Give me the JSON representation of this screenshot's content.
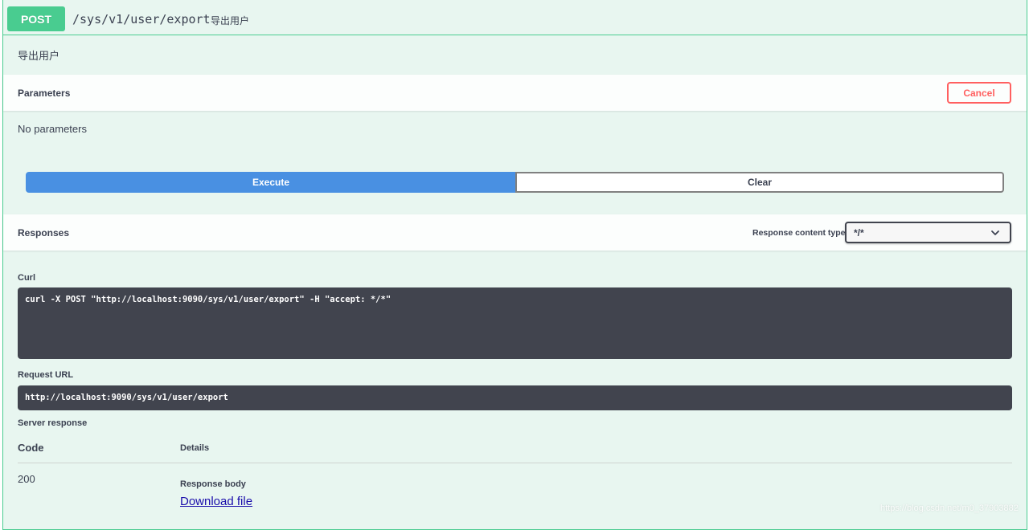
{
  "summary": {
    "method": "POST",
    "path": "/sys/v1/user/export",
    "description": "导出用户"
  },
  "description": "导出用户",
  "parameters": {
    "title": "Parameters",
    "cancel_label": "Cancel",
    "empty_text": "No parameters"
  },
  "actions": {
    "execute_label": "Execute",
    "clear_label": "Clear"
  },
  "responses": {
    "title": "Responses",
    "content_type_label": "Response content type",
    "content_type_value": "*/*"
  },
  "curl": {
    "label": "Curl",
    "command": "curl -X POST \"http://localhost:9090/sys/v1/user/export\" -H \"accept: */*\""
  },
  "request_url": {
    "label": "Request URL",
    "value": "http://localhost:9090/sys/v1/user/export"
  },
  "server_response": {
    "label": "Server response",
    "code_header": "Code",
    "details_header": "Details",
    "code": "200",
    "body_label": "Response body",
    "download_label": "Download file"
  },
  "watermark": "https://blog.csdn.net/m0_37903882",
  "colors": {
    "post_green": "#49cc90",
    "execute_blue": "#4990e2",
    "cancel_red": "#ff6060",
    "code_bg": "#41444e"
  }
}
